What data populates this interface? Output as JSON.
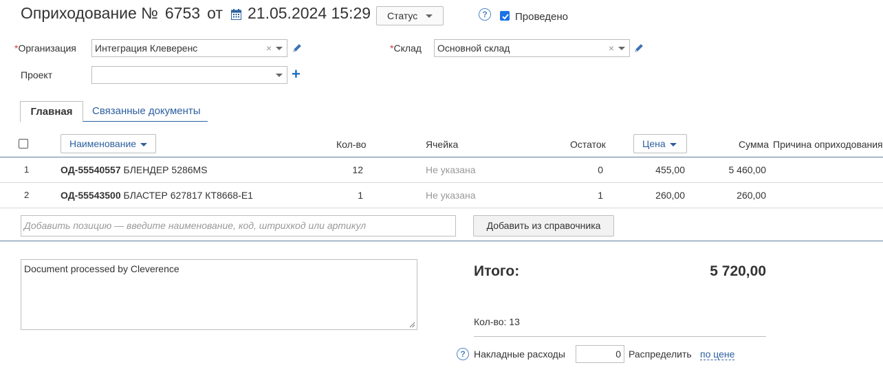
{
  "header": {
    "title": "Оприходование №",
    "number": "6753",
    "from_label": "от",
    "date": "21.05.2024 15:29",
    "status_button": "Статус",
    "posted_label": "Проведено",
    "posted_checked": true,
    "help_symbol": "?"
  },
  "form": {
    "required_mark": "*",
    "organization_label": "Организация",
    "organization_value": "Интеграция Клеверенс",
    "warehouse_label": "Склад",
    "warehouse_value": "Основной склад",
    "project_label": "Проект",
    "project_value": "",
    "clear_symbol": "×",
    "add_symbol": "+"
  },
  "tabs": [
    {
      "label": "Главная",
      "active": true
    },
    {
      "label": "Связанные документы",
      "active": false
    }
  ],
  "table": {
    "columns": {
      "name": "Наименование",
      "qty": "Кол-во",
      "cell": "Ячейка",
      "stock": "Остаток",
      "price": "Цена",
      "sum": "Сумма",
      "reason": "Причина оприходования"
    },
    "rows": [
      {
        "index": "1",
        "code": "ОД-55540557",
        "name": "БЛЕНДЕР 5286MS",
        "qty": "12",
        "cell": "Не указана",
        "stock": "0",
        "price": "455,00",
        "sum": "5 460,00",
        "reason": ""
      },
      {
        "index": "2",
        "code": "ОД-55543500",
        "name": "БЛАСТЕР 627817 КТ8668-Е1",
        "qty": "1",
        "cell": "Не указана",
        "stock": "1",
        "price": "260,00",
        "sum": "260,00",
        "reason": ""
      }
    ],
    "add_placeholder": "Добавить позицию — введите наименование, код, штрихкод или артикул",
    "add_from_catalog": "Добавить из справочника"
  },
  "footer": {
    "comment": "Document processed by Cleverence",
    "total_label": "Итого:",
    "total_value": "5 720,00",
    "qty_text": "Кол-во: 13",
    "overhead_label": "Накладные расходы",
    "overhead_value": "0",
    "distribute_label": "Распределить",
    "distribute_link": "по цене"
  },
  "colors": {
    "accent": "#2b5f9e",
    "required": "#d43b3b",
    "checkbox": "#1a73e8"
  },
  "icons": [
    "calendar-icon",
    "help-icon",
    "pencil-icon",
    "plus-icon",
    "chevron-down-icon",
    "clear-icon",
    "resize-handle-icon"
  ]
}
